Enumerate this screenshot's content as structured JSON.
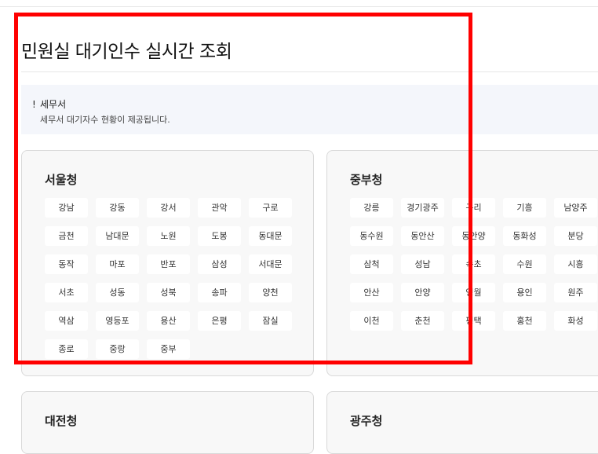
{
  "page": {
    "title": "민원실 대기인수 실시간 조회"
  },
  "notice": {
    "mark": "!",
    "heading": "세무서",
    "body": "세무서 대기자수 현황이 제공됩니다."
  },
  "offices": [
    {
      "name": "서울청",
      "branches": [
        "강남",
        "강동",
        "강서",
        "관악",
        "구로",
        "금천",
        "남대문",
        "노원",
        "도봉",
        "동대문",
        "동작",
        "마포",
        "반포",
        "삼성",
        "서대문",
        "서초",
        "성동",
        "성북",
        "송파",
        "양천",
        "역삼",
        "영등포",
        "용산",
        "은평",
        "잠실",
        "종로",
        "중랑",
        "중부"
      ]
    },
    {
      "name": "중부청",
      "branches": [
        "강릉",
        "경기광주",
        "구리",
        "기흥",
        "남양주",
        "동수원",
        "동안산",
        "동안양",
        "동화성",
        "분당",
        "삼척",
        "성남",
        "속초",
        "수원",
        "시흥",
        "안산",
        "안양",
        "영월",
        "용인",
        "원주",
        "이천",
        "춘천",
        "평택",
        "홍천",
        "화성"
      ]
    },
    {
      "name": "대전청",
      "branches": []
    },
    {
      "name": "광주청",
      "branches": []
    }
  ],
  "highlight": {
    "color": "#ff0000"
  }
}
